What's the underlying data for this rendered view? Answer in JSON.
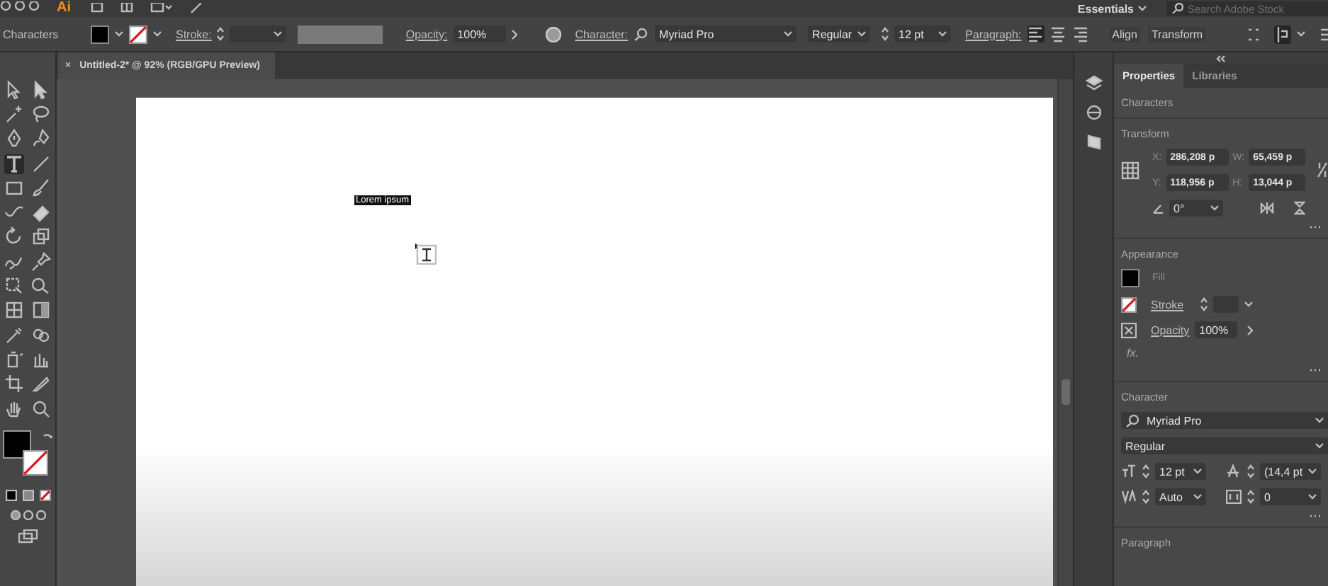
{
  "app_bar": {
    "logo": "Ai",
    "workspace": "Essentials",
    "search": {
      "placeholder": "Search Adobe Stock"
    }
  },
  "control_bar": {
    "selection_label": "Characters",
    "stroke_label": "Stroke:",
    "opacity_label": "Opacity:",
    "opacity": "100%",
    "character_label": "Character:",
    "font": "Myriad Pro",
    "font_style": "Regular",
    "font_size": "12 pt",
    "paragraph_label": "Paragraph:",
    "alignment": [
      {
        "kind": "left",
        "selected": true
      },
      {
        "kind": "center",
        "selected": false
      },
      {
        "kind": "right",
        "selected": false
      }
    ],
    "links": [
      "Align",
      "Transform"
    ]
  },
  "document_tab": {
    "close": "×",
    "title": "Untitled-2* @ 92% (RGB/GPU Preview)"
  },
  "tools": [
    {
      "kind": "hollow-arrow",
      "selected": false
    },
    {
      "kind": "arrow",
      "selected": false
    },
    {
      "kind": "wand",
      "selected": false
    },
    {
      "kind": "lasso",
      "selected": false
    },
    {
      "kind": "pen",
      "selected": false
    },
    {
      "kind": "curve-pen",
      "selected": false
    },
    {
      "kind": "type",
      "selected": true
    },
    {
      "kind": "line",
      "selected": false
    },
    {
      "kind": "rectangle",
      "selected": false
    },
    {
      "kind": "brush",
      "selected": false
    },
    {
      "kind": "squiggle",
      "selected": false
    },
    {
      "kind": "eraser",
      "selected": false
    },
    {
      "kind": "rotate",
      "selected": false
    },
    {
      "kind": "scale",
      "selected": false
    },
    {
      "kind": "warp",
      "selected": false
    },
    {
      "kind": "pin",
      "selected": false
    },
    {
      "kind": "transform",
      "selected": false
    },
    {
      "kind": "shape-builder",
      "selected": false
    },
    {
      "kind": "mesh",
      "selected": false
    },
    {
      "kind": "gradient",
      "selected": false
    },
    {
      "kind": "eyedropper",
      "selected": false
    },
    {
      "kind": "blend",
      "selected": false
    },
    {
      "kind": "sprayer",
      "selected": false
    },
    {
      "kind": "bar-chart",
      "selected": false
    },
    {
      "kind": "artboard",
      "selected": false
    },
    {
      "kind": "knife",
      "selected": false
    },
    {
      "kind": "hand",
      "selected": false
    },
    {
      "kind": "zoom",
      "selected": false
    }
  ],
  "canvas": {
    "text": "Lorem ipsum",
    "text_selected": true
  },
  "panel": {
    "tabs": [
      {
        "label": "Properties",
        "selected": true
      },
      {
        "label": "Libraries",
        "selected": false
      }
    ],
    "selection_label": "Characters",
    "transform": {
      "title": "Transform",
      "fields": [
        {
          "label": "X:",
          "value": "286,208 p"
        },
        {
          "label": "W:",
          "value": "65,459 p"
        },
        {
          "label": "Y:",
          "value": "118,956 p"
        },
        {
          "label": "H:",
          "value": "13,044 p"
        }
      ],
      "angle": "0°"
    },
    "appearance": {
      "title": "Appearance",
      "fill_label": "Fill",
      "stroke_label": "Stroke",
      "opacity_label": "Opacity",
      "opacity": "100%",
      "effects": "fx."
    },
    "character": {
      "title": "Character",
      "font": "Myriad Pro",
      "font_style": "Regular",
      "size": "12 pt",
      "leading": "(14,4 pt",
      "kerning": "Auto",
      "tracking": "0"
    },
    "paragraph": {
      "title": "Paragraph"
    }
  }
}
